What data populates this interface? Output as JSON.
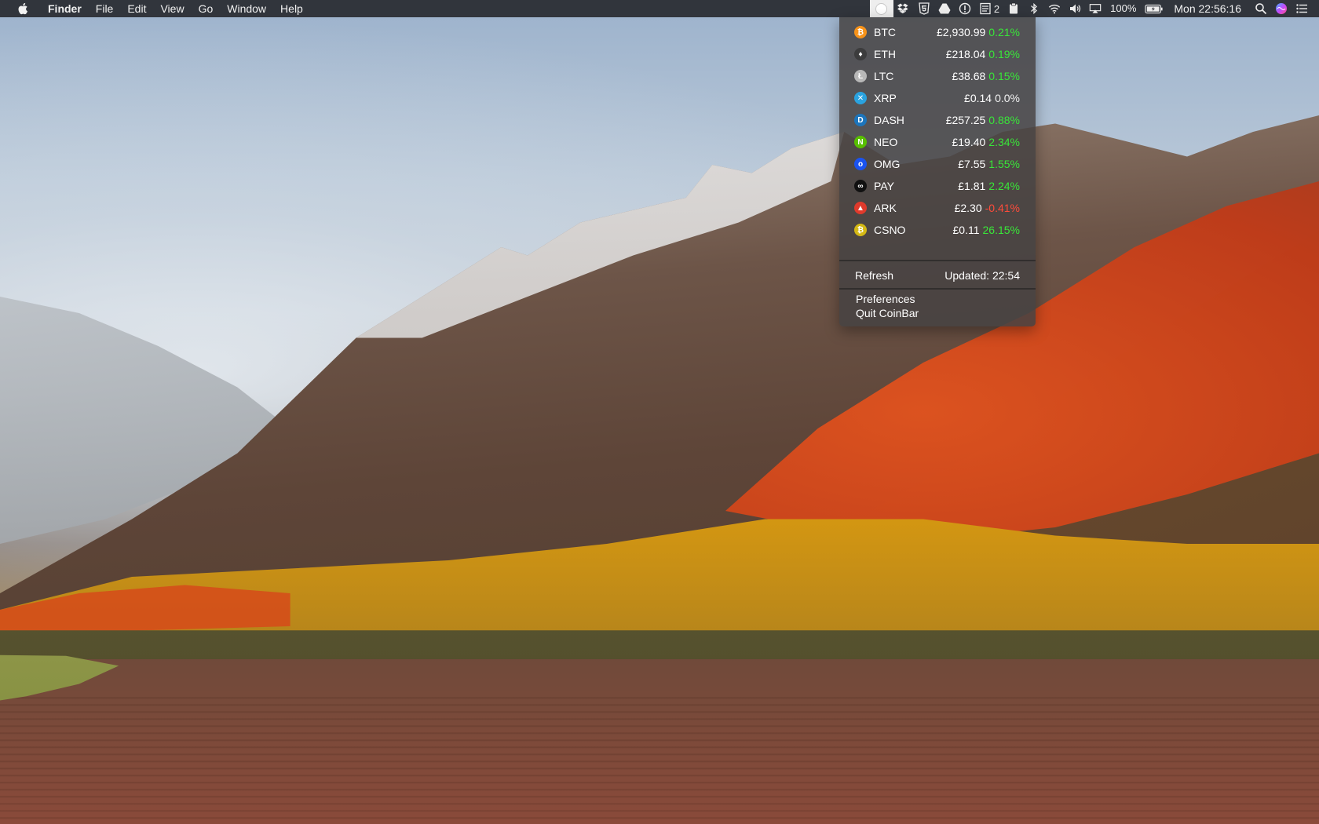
{
  "menubar": {
    "app_name": "Finder",
    "menus": [
      "File",
      "Edit",
      "View",
      "Go",
      "Window",
      "Help"
    ],
    "status_icons": {
      "coinbar": "coinbar-status-icon",
      "dropbox": "dropbox-icon",
      "html5": "html5-icon",
      "drive": "google-drive-icon",
      "istat": "istat-icon",
      "notes_badge": "2",
      "clipboard": "clipboard-icon",
      "bluetooth": "bluetooth-icon",
      "wifi": "wifi-icon",
      "volume": "volume-icon",
      "airplay": "airplay-icon"
    },
    "battery_percent": "100%",
    "clock": "Mon 22:56:16"
  },
  "coinbar": {
    "coins": [
      {
        "symbol": "BTC",
        "price": "£2,930.99",
        "change": "0.21%",
        "trend": "pos",
        "icon_color": "#f7931a",
        "icon_glyph": "₿"
      },
      {
        "symbol": "ETH",
        "price": "£218.04",
        "change": "0.19%",
        "trend": "pos",
        "icon_color": "#3c3c3d",
        "icon_glyph": "♦"
      },
      {
        "symbol": "LTC",
        "price": "£38.68",
        "change": "0.15%",
        "trend": "pos",
        "icon_color": "#b8b8b8",
        "icon_glyph": "Ł"
      },
      {
        "symbol": "XRP",
        "price": "£0.14",
        "change": "0.0%",
        "trend": "zero",
        "icon_color": "#2aa3e0",
        "icon_glyph": "✕"
      },
      {
        "symbol": "DASH",
        "price": "£257.25",
        "change": "0.88%",
        "trend": "pos",
        "icon_color": "#1c75bc",
        "icon_glyph": "D"
      },
      {
        "symbol": "NEO",
        "price": "£19.40",
        "change": "2.34%",
        "trend": "pos",
        "icon_color": "#58bf00",
        "icon_glyph": "N"
      },
      {
        "symbol": "OMG",
        "price": "£7.55",
        "change": "1.55%",
        "trend": "pos",
        "icon_color": "#1a53f0",
        "icon_glyph": "o"
      },
      {
        "symbol": "PAY",
        "price": "£1.81",
        "change": "2.24%",
        "trend": "pos",
        "icon_color": "#111111",
        "icon_glyph": "∞"
      },
      {
        "symbol": "ARK",
        "price": "£2.30",
        "change": "-0.41%",
        "trend": "neg",
        "icon_color": "#e03a2c",
        "icon_glyph": "▲"
      },
      {
        "symbol": "CSNO",
        "price": "£0.11",
        "change": "26.15%",
        "trend": "pos",
        "icon_color": "#d4b814",
        "icon_glyph": "₿"
      }
    ],
    "refresh_label": "Refresh",
    "updated_label": "Updated: 22:54",
    "preferences_label": "Preferences",
    "quit_label": "Quit CoinBar"
  }
}
